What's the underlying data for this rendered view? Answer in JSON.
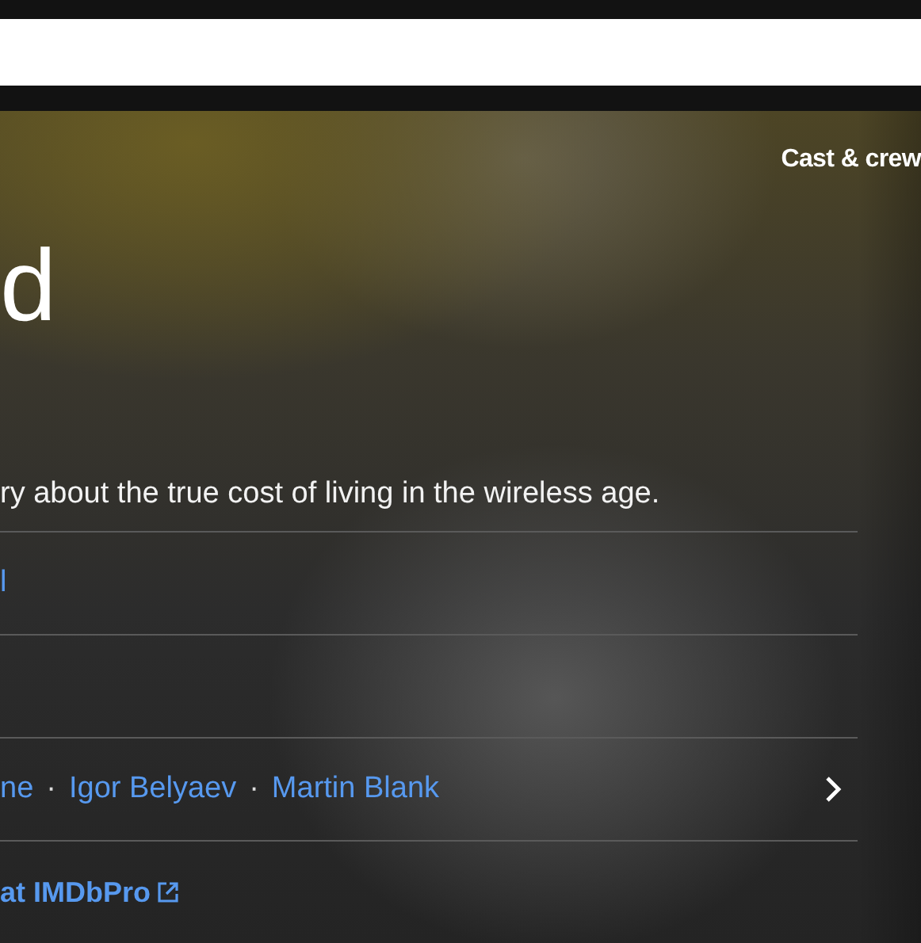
{
  "hero": {
    "nav_link": "Cast & crew",
    "title": "d",
    "plot": "ry about the true cost of living in the wireless age.",
    "rows": [
      {
        "kind": "link",
        "text": "l"
      },
      {
        "kind": "empty"
      },
      {
        "kind": "credits",
        "separator": "·",
        "names": [
          "ne",
          "Igor Belyaev",
          "Martin Blank"
        ]
      },
      {
        "kind": "pro",
        "text": "at IMDbPro"
      }
    ]
  }
}
